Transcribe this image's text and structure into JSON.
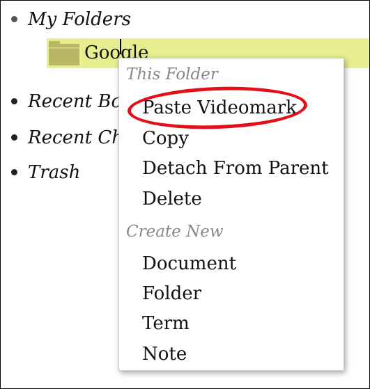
{
  "tree": {
    "my_folders": "My Folders",
    "folder_name": "Google",
    "recent_bookmarks": "Recent Bo",
    "recent_changes": "Recent Ch",
    "trash": "Trash"
  },
  "context_menu": {
    "this_folder_header": "This Folder",
    "this_folder_items": [
      "Paste Videomark",
      "Copy",
      "Detach From Parent",
      "Delete"
    ],
    "create_new_header": "Create New",
    "create_new_items": [
      "Document",
      "Folder",
      "Term",
      "Note"
    ]
  },
  "colors": {
    "selection_highlight": "#e6ee90",
    "folder_icon": "#b9b664",
    "annotation": "#e3101a"
  },
  "icons": [
    "folder-icon"
  ]
}
